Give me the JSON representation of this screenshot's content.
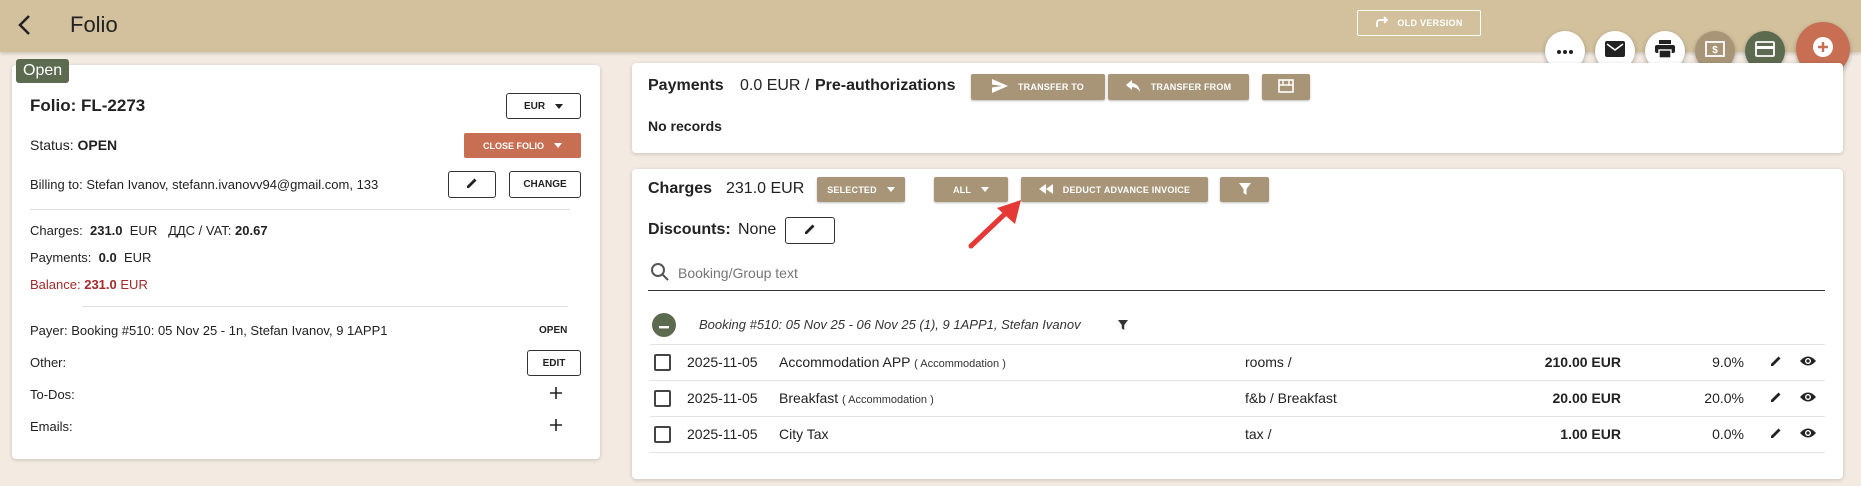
{
  "header": {
    "title": "Folio",
    "old_version_label": "OLD VERSION"
  },
  "fabs": [
    {
      "icon": "more-icon"
    },
    {
      "icon": "mail-icon"
    },
    {
      "icon": "print-icon"
    },
    {
      "icon": "cash-icon"
    },
    {
      "icon": "credit-card-icon"
    },
    {
      "icon": "add-icon"
    }
  ],
  "folio": {
    "status_chip": "Open",
    "title": "Folio: FL-2273",
    "currency": "EUR",
    "status_label": "Status:",
    "status_value": "OPEN",
    "close_folio_label": "CLOSE FOLIO",
    "billing_label": "Billing to:",
    "billing_value": "Stefan Ivanov, stefann.ivanovv94@gmail.com, 133",
    "change_label": "CHANGE",
    "charges_label": "Charges:",
    "charges_value": "231.0",
    "charges_currency": "EUR",
    "vat_label": "ДДС / VAT:",
    "vat_value": "20.67",
    "payments_label": "Payments:",
    "payments_value": "0.0",
    "payments_currency": "EUR",
    "balance_label": "Balance:",
    "balance_value": "231.0",
    "balance_currency": "EUR",
    "payer_label": "Payer:",
    "payer_value": "Booking #510: 05 Nov 25 - 1n, Stefan Ivanov, 9 1APP1",
    "payer_open_label": "OPEN",
    "other_label": "Other:",
    "edit_label": "EDIT",
    "todos_label": "To-Dos:",
    "emails_label": "Emails:"
  },
  "payments": {
    "title": "Payments",
    "amount": "0.0 EUR /",
    "preauth_label": "Pre-authorizations",
    "transfer_to_label": "TRANSFER TO",
    "transfer_from_label": "TRANSFER FROM",
    "no_records": "No records"
  },
  "charges": {
    "title": "Charges",
    "amount": "231.0 EUR",
    "selected_label": "SELECTED",
    "all_label": "ALL",
    "deduct_label": "DEDUCT ADVANCE INVOICE",
    "discounts_label": "Discounts:",
    "discounts_value": "None",
    "search_placeholder": "Booking/Group text",
    "group_title": "Booking #510: 05 Nov 25 - 06 Nov 25 (1), 9 1APP1, Stefan Ivanov",
    "rows": [
      {
        "date": "2025-11-05",
        "name": "Accommodation APP",
        "category": "( Accommodation )",
        "dept": "rooms /",
        "amount": "210.00 EUR",
        "vat": "9.0%"
      },
      {
        "date": "2025-11-05",
        "name": "Breakfast",
        "category": "( Accommodation )",
        "dept": "f&b / Breakfast",
        "amount": "20.00 EUR",
        "vat": "20.0%"
      },
      {
        "date": "2025-11-05",
        "name": "City Tax",
        "category": "",
        "dept": "tax /",
        "amount": "1.00 EUR",
        "vat": "0.0%"
      }
    ]
  },
  "colors": {
    "header_bg": "#d2c19c",
    "page_bg": "#f3ebe2",
    "tan_button": "#a89577",
    "close_button": "#c86f53",
    "status_chip": "#5c6b50",
    "balance_red": "#a52a2a",
    "add_fab": "#c86f53"
  }
}
